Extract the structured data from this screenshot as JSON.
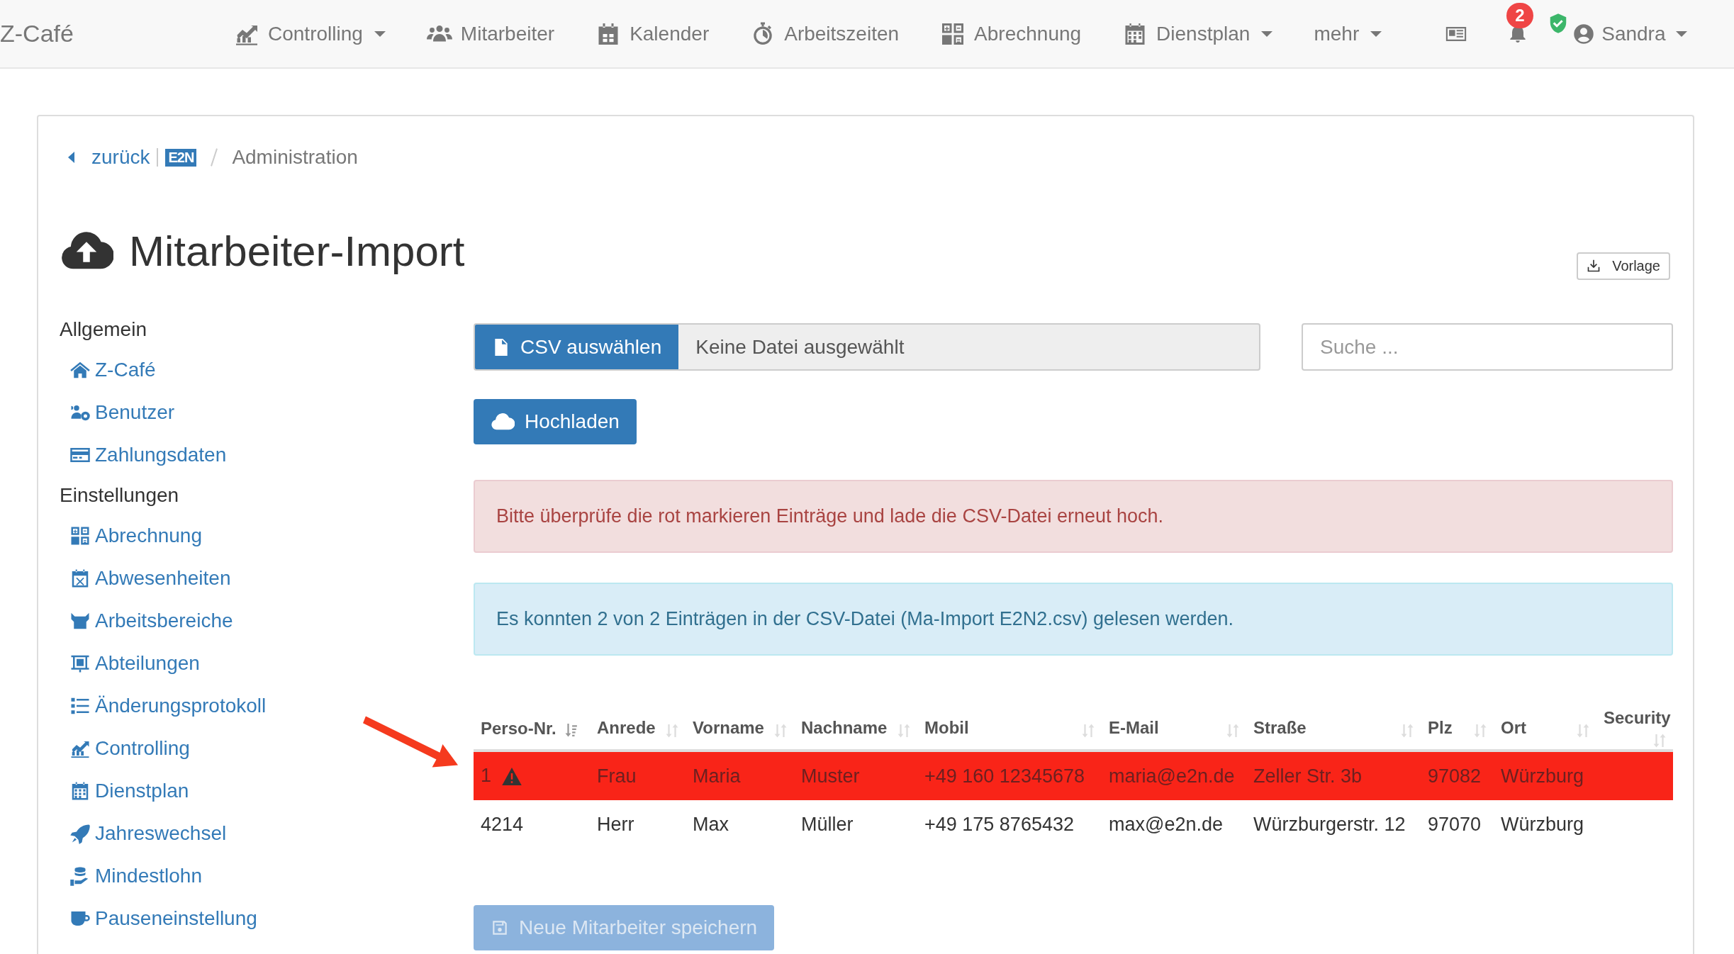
{
  "navbar": {
    "brand": "Z-Café",
    "items": [
      {
        "label": "Controlling",
        "caret": true
      },
      {
        "label": "Mitarbeiter",
        "caret": false
      },
      {
        "label": "Kalender",
        "caret": false
      },
      {
        "label": "Arbeitszeiten",
        "caret": false
      },
      {
        "label": "Abrechnung",
        "caret": false
      },
      {
        "label": "Dienstplan",
        "caret": true
      },
      {
        "label": "mehr",
        "caret": true
      }
    ],
    "notification_count": "2",
    "user": {
      "name": "Sandra",
      "caret": true
    }
  },
  "breadcrumb": {
    "back": "zurück",
    "logo": "E2N",
    "current": "Administration"
  },
  "page_title": "Mitarbeiter-Import",
  "template_button": "Vorlage",
  "sidebar": [
    {
      "title": "Allgemein",
      "items": [
        {
          "label": "Z-Café"
        },
        {
          "label": "Benutzer"
        },
        {
          "label": "Zahlungsdaten"
        }
      ]
    },
    {
      "title": "Einstellungen",
      "items": [
        {
          "label": "Abrechnung"
        },
        {
          "label": "Abwesenheiten"
        },
        {
          "label": "Arbeitsbereiche"
        },
        {
          "label": "Abteilungen"
        },
        {
          "label": "Änderungsprotokoll"
        },
        {
          "label": "Controlling"
        },
        {
          "label": "Dienstplan"
        },
        {
          "label": "Jahreswechsel"
        },
        {
          "label": "Mindestlohn"
        },
        {
          "label": "Pauseneinstellung"
        }
      ]
    }
  ],
  "file_picker": {
    "button": "CSV auswählen",
    "value": "Keine Datei ausgewählt"
  },
  "search": {
    "placeholder": "Suche ..."
  },
  "upload_button": "Hochladen",
  "alerts": [
    {
      "kind": "danger",
      "text": "Bitte überprüfe die rot markieren Einträge und lade die CSV-Datei erneut hoch."
    },
    {
      "kind": "info",
      "text": "Es konnten 2 von 2 Einträgen in der CSV-Datei (Ma-Import E2N2.csv) gelesen werden."
    }
  ],
  "table": {
    "columns": [
      {
        "label": "Perso-Nr.",
        "sorted": true
      },
      {
        "label": "Anrede",
        "sorted": false
      },
      {
        "label": "Vorname",
        "sorted": false
      },
      {
        "label": "Nachname",
        "sorted": false
      },
      {
        "label": "Mobil",
        "sorted": false
      },
      {
        "label": "E-Mail",
        "sorted": false
      },
      {
        "label": "Straße",
        "sorted": false
      },
      {
        "label": "Plz",
        "sorted": false
      },
      {
        "label": "Ort",
        "sorted": false
      },
      {
        "label": "Security",
        "sorted": false
      }
    ],
    "rows": [
      {
        "error": true,
        "cells": [
          "1",
          "Frau",
          "Maria",
          "Muster",
          "+49 160 12345678",
          "maria@e2n.de",
          "Zeller Str. 3b",
          "97082",
          "Würzburg"
        ]
      },
      {
        "error": false,
        "cells": [
          "4214",
          "Herr",
          "Max",
          "Müller",
          "+49 175 8765432",
          "max@e2n.de",
          "Würzburgerstr. 12",
          "97070",
          "Würzburg"
        ]
      }
    ]
  },
  "save_button": {
    "label": "Neue Mitarbeiter speichern",
    "disabled": true
  }
}
